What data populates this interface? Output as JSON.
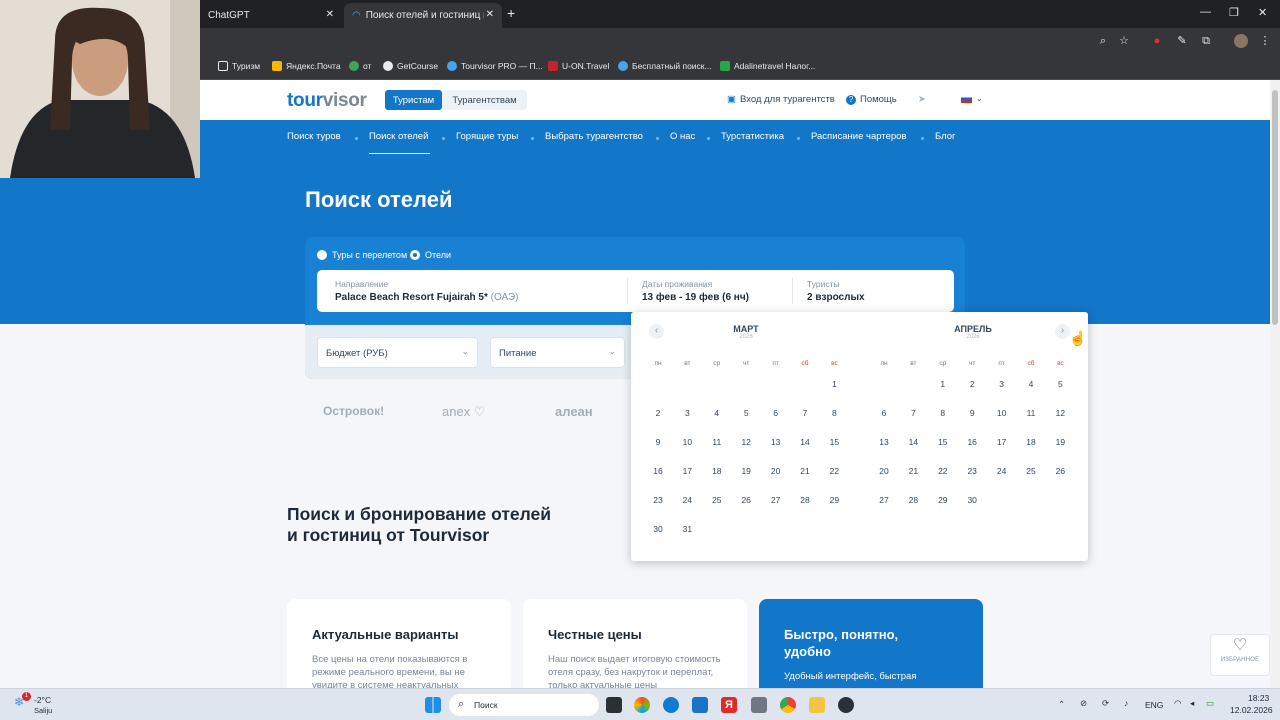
{
  "browser": {
    "tabs": [
      {
        "label": "ChatGPT"
      },
      {
        "label": "Поиск отелей и гостиниц в Ро..."
      }
    ],
    "new_tab_icon": "plus-icon",
    "bookmarks": [
      {
        "label": "Туризм",
        "icon": "folder-icon"
      },
      {
        "label": "Яндекс.Почта",
        "icon": "mail-icon"
      },
      {
        "label": "от",
        "icon": "badge-icon"
      },
      {
        "label": "GetCourse",
        "icon": "globe-icon"
      },
      {
        "label": "Tourvisor PRO — П...",
        "icon": "tourvisor-icon"
      },
      {
        "label": "U-ON.Travel",
        "icon": "uon-icon"
      },
      {
        "label": "Бесплатный поиск...",
        "icon": "tourvisor-icon"
      },
      {
        "label": "Adalinetravel Налог...",
        "icon": "plus-icon"
      }
    ]
  },
  "site": {
    "logo_main": "tour",
    "logo_accent": "visor",
    "segments": {
      "tourists": "Туристам",
      "agencies": "Турагентствам"
    },
    "top_links": {
      "agent_login": "Вход для турагентств",
      "help": "Помощь"
    },
    "nav": [
      "Поиск туров",
      "Поиск отелей",
      "Горящие туры",
      "Выбрать турагентство",
      "О нас",
      "Турстатистика",
      "Расписание чартеров",
      "Блог"
    ],
    "title": "Поиск отелей",
    "search": {
      "radio_tours": "Туры с перелетом",
      "radio_hotels": "Отели",
      "direction_label": "Направление",
      "direction_value": "Palace Beach Resort Fujairah 5*",
      "direction_country": "(ОАЭ)",
      "dates_label": "Даты проживания",
      "dates_value": "13 фев - 19 фев (6 нч)",
      "tourists_label": "Туристы",
      "tourists_value": "2 взрослых",
      "budget_placeholder": "Бюджет (РУБ)",
      "meal_placeholder": "Питание"
    },
    "partners": [
      "Островок!",
      "anex ♡",
      "алеан"
    ],
    "section_title_line1": "Поиск и бронирование отелей",
    "section_title_line2": "и гостиниц от Tourvisor",
    "cards": [
      {
        "title": "Актуальные варианты",
        "text": "Все цены на отели показываются в режиме реального времени, вы не увидите в системе неактуальных"
      },
      {
        "title": "Честные цены",
        "text": "Наш поиск выдает итоговую стоимость отеля сразу, без накруток и переплат, только актуальные цены"
      },
      {
        "title": "Быстро, понятно, удобно",
        "text": "Удобный интерфейс, быстрая"
      }
    ],
    "favorites_label": "ИЗБРАННОЕ"
  },
  "calendar": {
    "weekdays": [
      "пн",
      "вт",
      "ср",
      "чт",
      "пт",
      "сб",
      "вс"
    ],
    "months": [
      {
        "name": "МАРТ",
        "year": "2026",
        "first_weekday": 6,
        "days": [
          "1",
          "2",
          "3",
          "4",
          "5",
          "6",
          "7",
          "8",
          "9",
          "10",
          "11",
          "12",
          "13",
          "14",
          "15",
          "16",
          "17",
          "18",
          "19",
          "20",
          "21",
          "22",
          "23",
          "24",
          "25",
          "26",
          "27",
          "28",
          "29",
          "30",
          "31"
        ]
      },
      {
        "name": "АПРЕЛЬ",
        "year": "2026",
        "first_weekday": 2,
        "days": [
          "1",
          "2",
          "3",
          "4",
          "5",
          "6",
          "7",
          "8",
          "9",
          "10",
          "11",
          "12",
          "13",
          "14",
          "15",
          "16",
          "17",
          "18",
          "19",
          "20",
          "21",
          "22",
          "23",
          "24",
          "25",
          "26",
          "27",
          "28",
          "29",
          "30"
        ]
      }
    ]
  },
  "taskbar": {
    "weather_temp": "-2°C",
    "weather_place": "Saliju",
    "weather_badge": "1",
    "search_placeholder": "Поиск",
    "lang": "ENG",
    "time": "18:23",
    "date": "12.02.2026"
  },
  "colors": {
    "brand": "#1276c9",
    "weekend": "#d8404a"
  }
}
